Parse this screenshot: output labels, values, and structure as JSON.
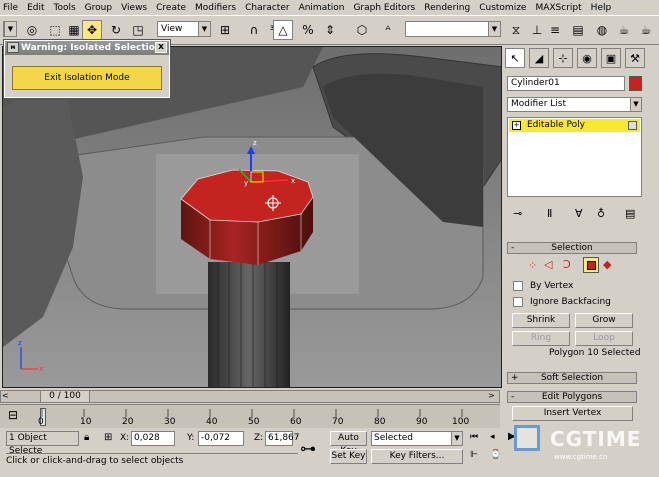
{
  "menu": [
    "File",
    "Edit",
    "Tools",
    "Group",
    "Views",
    "Create",
    "Modifiers",
    "Character",
    "Animation",
    "Graph Editors",
    "Rendering",
    "Customize",
    "MAXScript",
    "Help"
  ],
  "toolbar": {
    "view_combo": "View"
  },
  "warning": {
    "title": "Warning: Isolated Selection",
    "close": "x",
    "exit_button": "Exit Isolation Mode"
  },
  "command_panel": {
    "object_name": "Cylinder01",
    "modifier_list": "Modifier List",
    "stack_item": "Editable Poly",
    "selection_rollout": {
      "header": "Selection",
      "sign": "-",
      "by_vertex": "By Vertex",
      "ignore_backfacing": "Ignore Backfacing",
      "shrink": "Shrink",
      "grow": "Grow",
      "ring": "Ring",
      "loop": "Loop",
      "status": "Polygon 10 Selected"
    },
    "soft_selection": {
      "header": "Soft Selection",
      "sign": "+"
    },
    "edit_polygons": {
      "header": "Edit Polygons",
      "sign": "-",
      "insert_vertex": "Insert Vertex"
    }
  },
  "timeline": {
    "frame_counter": "0 / 100",
    "ticks": [
      "0",
      "10",
      "20",
      "30",
      "40",
      "50",
      "60",
      "70",
      "80",
      "90",
      "100"
    ]
  },
  "status": {
    "objects_selected": "1 Object Selecte",
    "x_label": "X:",
    "x_value": "0,028",
    "y_label": "Y:",
    "y_value": "-0,072",
    "z_label": "Z:",
    "z_value": "61,867",
    "auto_key": "Auto Key",
    "set_key": "Set Key",
    "selected_combo": "Selected",
    "key_filters": "Key Filters...",
    "prompt": "Click or click-and-drag to select objects"
  },
  "watermark": {
    "brand": "CGTIME",
    "url": "www.cgtime.cn"
  },
  "colors": {
    "selection_red": "#c3241f",
    "highlight_yellow": "#f8e830",
    "exit_button": "#f4d64a"
  }
}
